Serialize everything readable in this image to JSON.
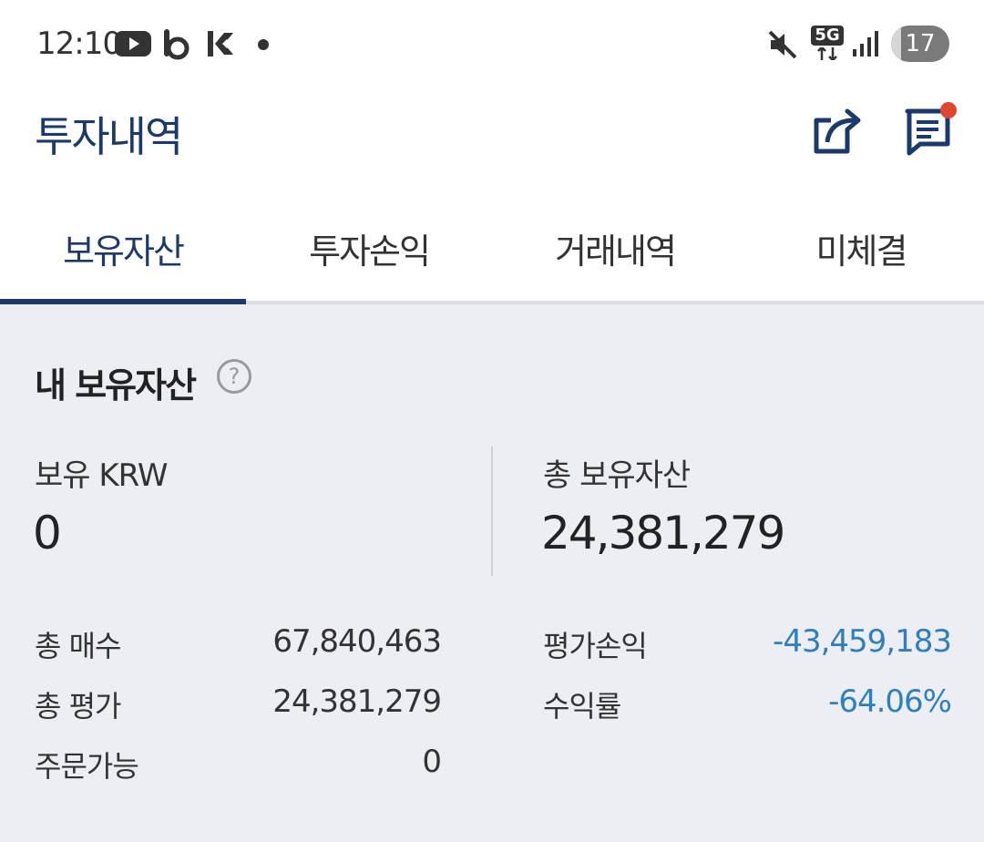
{
  "status_bar": {
    "time": "12:10",
    "app_icons": [
      "youtube-icon",
      "b-app-icon",
      "k-app-icon",
      "dot-icon"
    ],
    "right_icons": [
      "mute-icon",
      "5g-icon",
      "signal-icon"
    ],
    "network_label": "5G",
    "battery": "17",
    "battery_level": 0.17
  },
  "header": {
    "title": "투자내역",
    "icons": [
      "share-icon",
      "message-icon"
    ],
    "notification_color": "#e0452f"
  },
  "tabs": [
    {
      "label": "보유자산",
      "active": true
    },
    {
      "label": "투자손익",
      "active": false
    },
    {
      "label": "거래내역",
      "active": false
    },
    {
      "label": "미체결",
      "active": false
    }
  ],
  "assets": {
    "title": "내 보유자산",
    "help_icon": "?",
    "krw_label": "보유 KRW",
    "krw_value": "0",
    "total_label": "총 보유자산",
    "total_value": "24,381,279",
    "rows_left": [
      {
        "label": "총 매수",
        "value": "67,840,463"
      },
      {
        "label": "총 평가",
        "value": "24,381,279"
      },
      {
        "label": "주문가능",
        "value": "0"
      }
    ],
    "rows_right": [
      {
        "label": "평가손익",
        "value": "-43,459,183"
      },
      {
        "label": "수익률",
        "value": "-64.06%"
      }
    ]
  },
  "colors": {
    "brand": "#1b3a6b",
    "negative": "#2f7fbf",
    "panel_bg": "#eceef4"
  }
}
